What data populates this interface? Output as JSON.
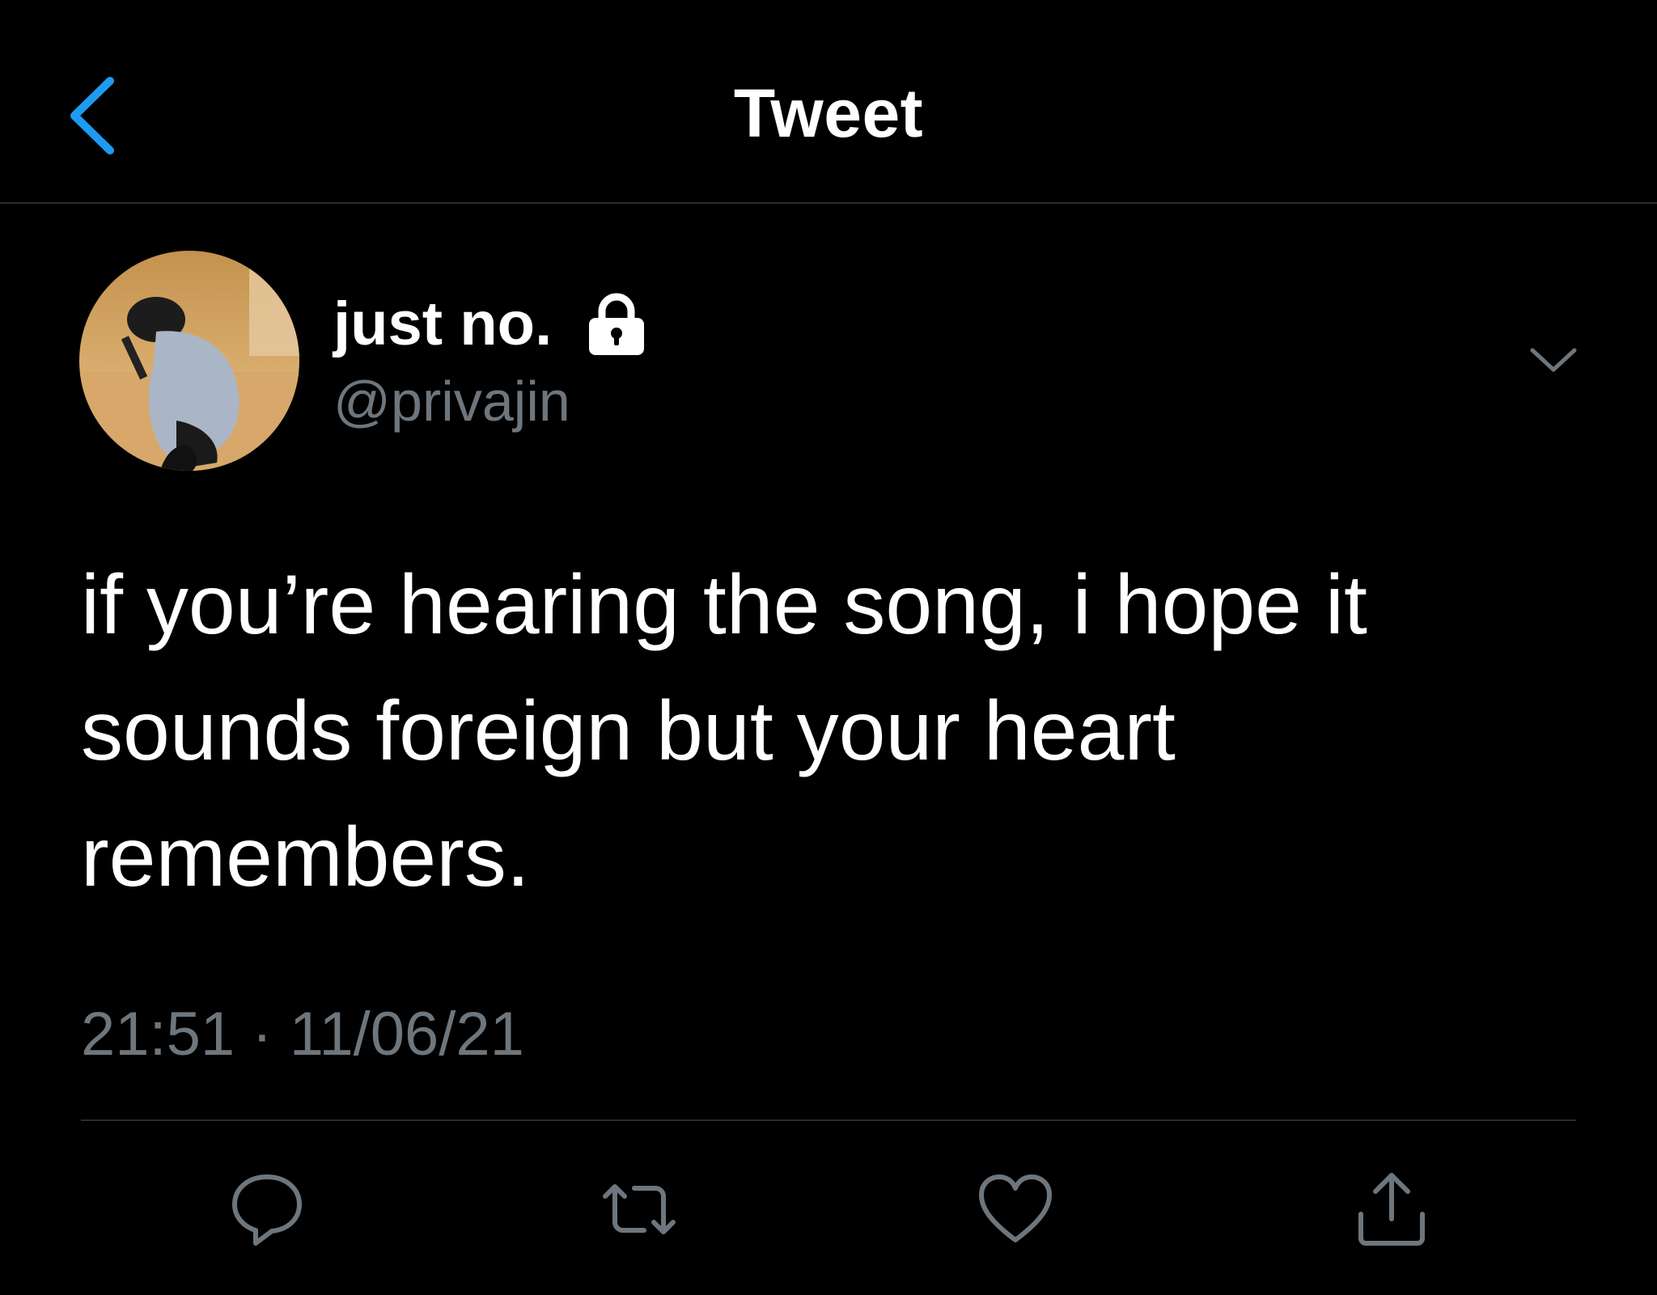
{
  "header": {
    "title": "Tweet",
    "back_icon": "chevron-left-icon",
    "accent_color": "#1d9bf0"
  },
  "tweet": {
    "author": {
      "display_name": "just no.",
      "handle": "@privajin",
      "protected_icon": "lock-icon"
    },
    "text": "if you’re hearing the song, i hope it sounds foreign but your heart remembers.",
    "timestamp": "21:51 · 11/06/21",
    "menu_icon": "chevron-down-icon"
  },
  "actions": [
    {
      "name": "reply",
      "icon": "reply-icon"
    },
    {
      "name": "retweet",
      "icon": "retweet-icon"
    },
    {
      "name": "like",
      "icon": "heart-icon"
    },
    {
      "name": "share",
      "icon": "share-icon"
    }
  ],
  "colors": {
    "background": "#000000",
    "text": "#ffffff",
    "secondary_text": "#6e767d",
    "divider": "#2a2e33"
  }
}
